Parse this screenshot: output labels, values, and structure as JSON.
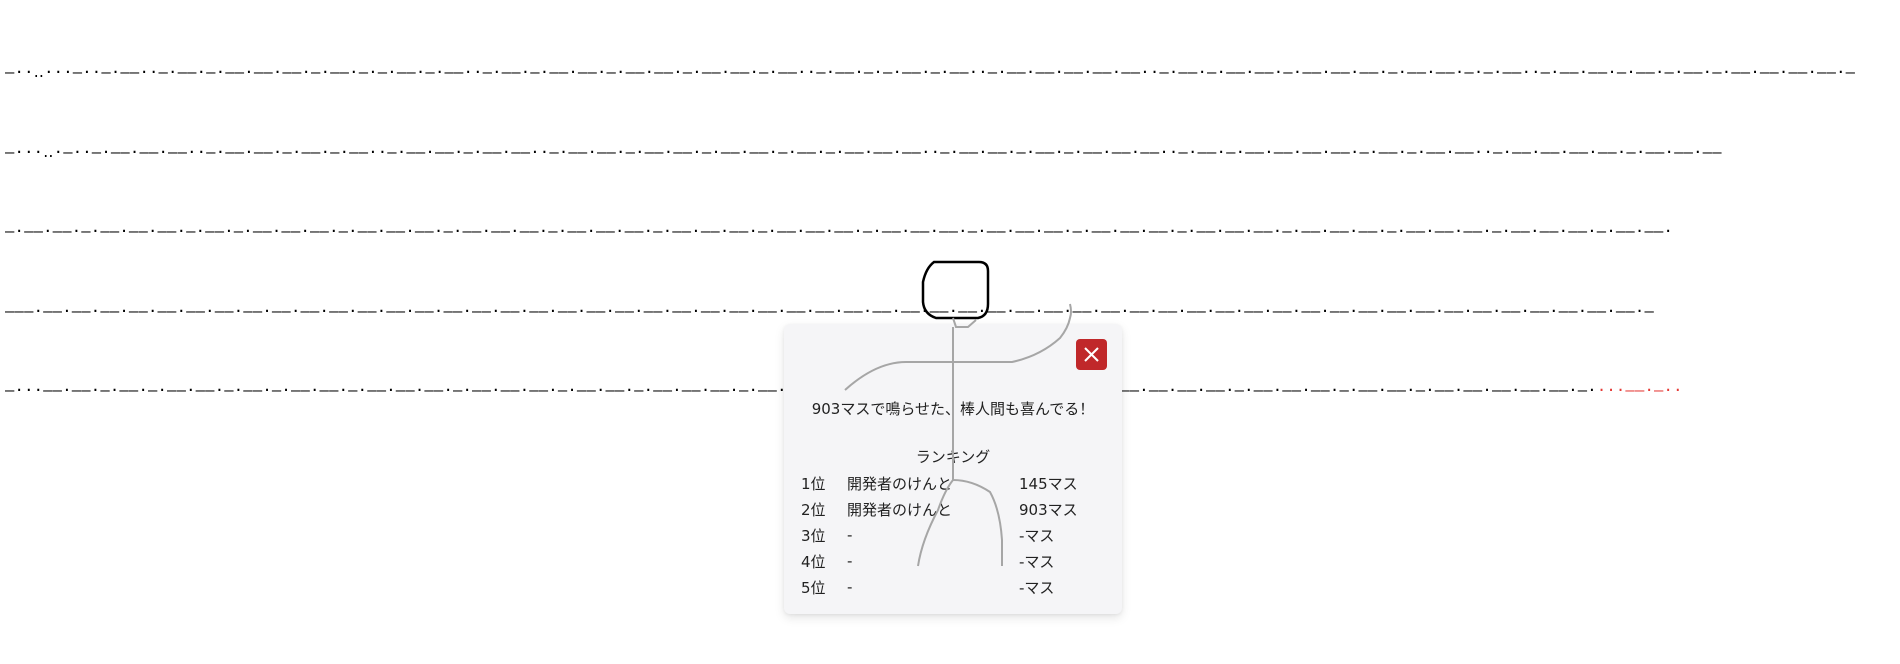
{
  "morse": {
    "lines": [
      "—··‥···—··—·——··—·——·—·——·——·——·—·——·—·—·——·—·——··—·——·—·——·——·—·——·——·—·——·——·—·——··—·——·—·—·——·—·——··—·——·——·——·——·——··—·——·—·——·——·—·——·——·——·—·——·——·—·—·——··—·——·——·—·——·—·——·—·——·——·——·——·—",
      "—···‥·—··—·——·——·——··—·——·——·—·——·—·——··—·——·——·—·——·——··—·——·——·—·——·——·—·——·——·—·——·—·——·——·——··—·——·——·—·——·—·——·——·——··—·——·—·——·——·——·——·—·——·—·——·——··—·——·——·——·——·—·——·——·——",
      "—·——·——·—·——·——·——·—·——·—·——·——·——·—·——·——·——·—·——·——·——·—·——·——·——·—·——·——·——·—·——·——·——·—·——·——·——·—·——·——·——·—·——·——·——·—·——·——·——·—·——·——·——·—·——·——·——·—·——·——·——·—·——·——·",
      "———·——·——·——·——·——·——·——·——·——·——·——·——·——·——·——·——·——·——·——·——·——·——·——·——·——·——·——·——·——·——·——·——·——·——·——·——·——·——·——·——·——·——·——·——·——·——·——·——·——·——·——·——·——·——·——·——·—"
    ],
    "last_line": "—···——·——·—·——·—·——·——·—·——·—·——·——·—·——·——·——·—·——·——·——·—·——·——·—·——·——·——·—·——·——·—·——·——·——·—·——·——·——·—·——·——·—·——·——·——·——·—·——·——·——·—·——·——·—·——·——·——·——·——·—·",
    "last_line_tail": "···——·—··"
  },
  "dialog": {
    "message": "903マスで鳴らせた、棒人間も喜んでる！",
    "ranking_title": "ランキング",
    "rows": [
      {
        "rank": "1位",
        "name": "開発者のけんと",
        "count": "145マス"
      },
      {
        "rank": "2位",
        "name": "開発者のけんと",
        "count": "903マス"
      },
      {
        "rank": "3位",
        "name": "-",
        "count": "-マス"
      },
      {
        "rank": "4位",
        "name": "-",
        "count": "-マス"
      },
      {
        "rank": "5位",
        "name": "-",
        "count": "-マス"
      }
    ],
    "close_icon": "close-icon"
  },
  "colors": {
    "close_button": "#c0282a",
    "morse_tail": "#e53935",
    "stickman_head": "#000000",
    "stickman_body": "#a6a6a6"
  }
}
